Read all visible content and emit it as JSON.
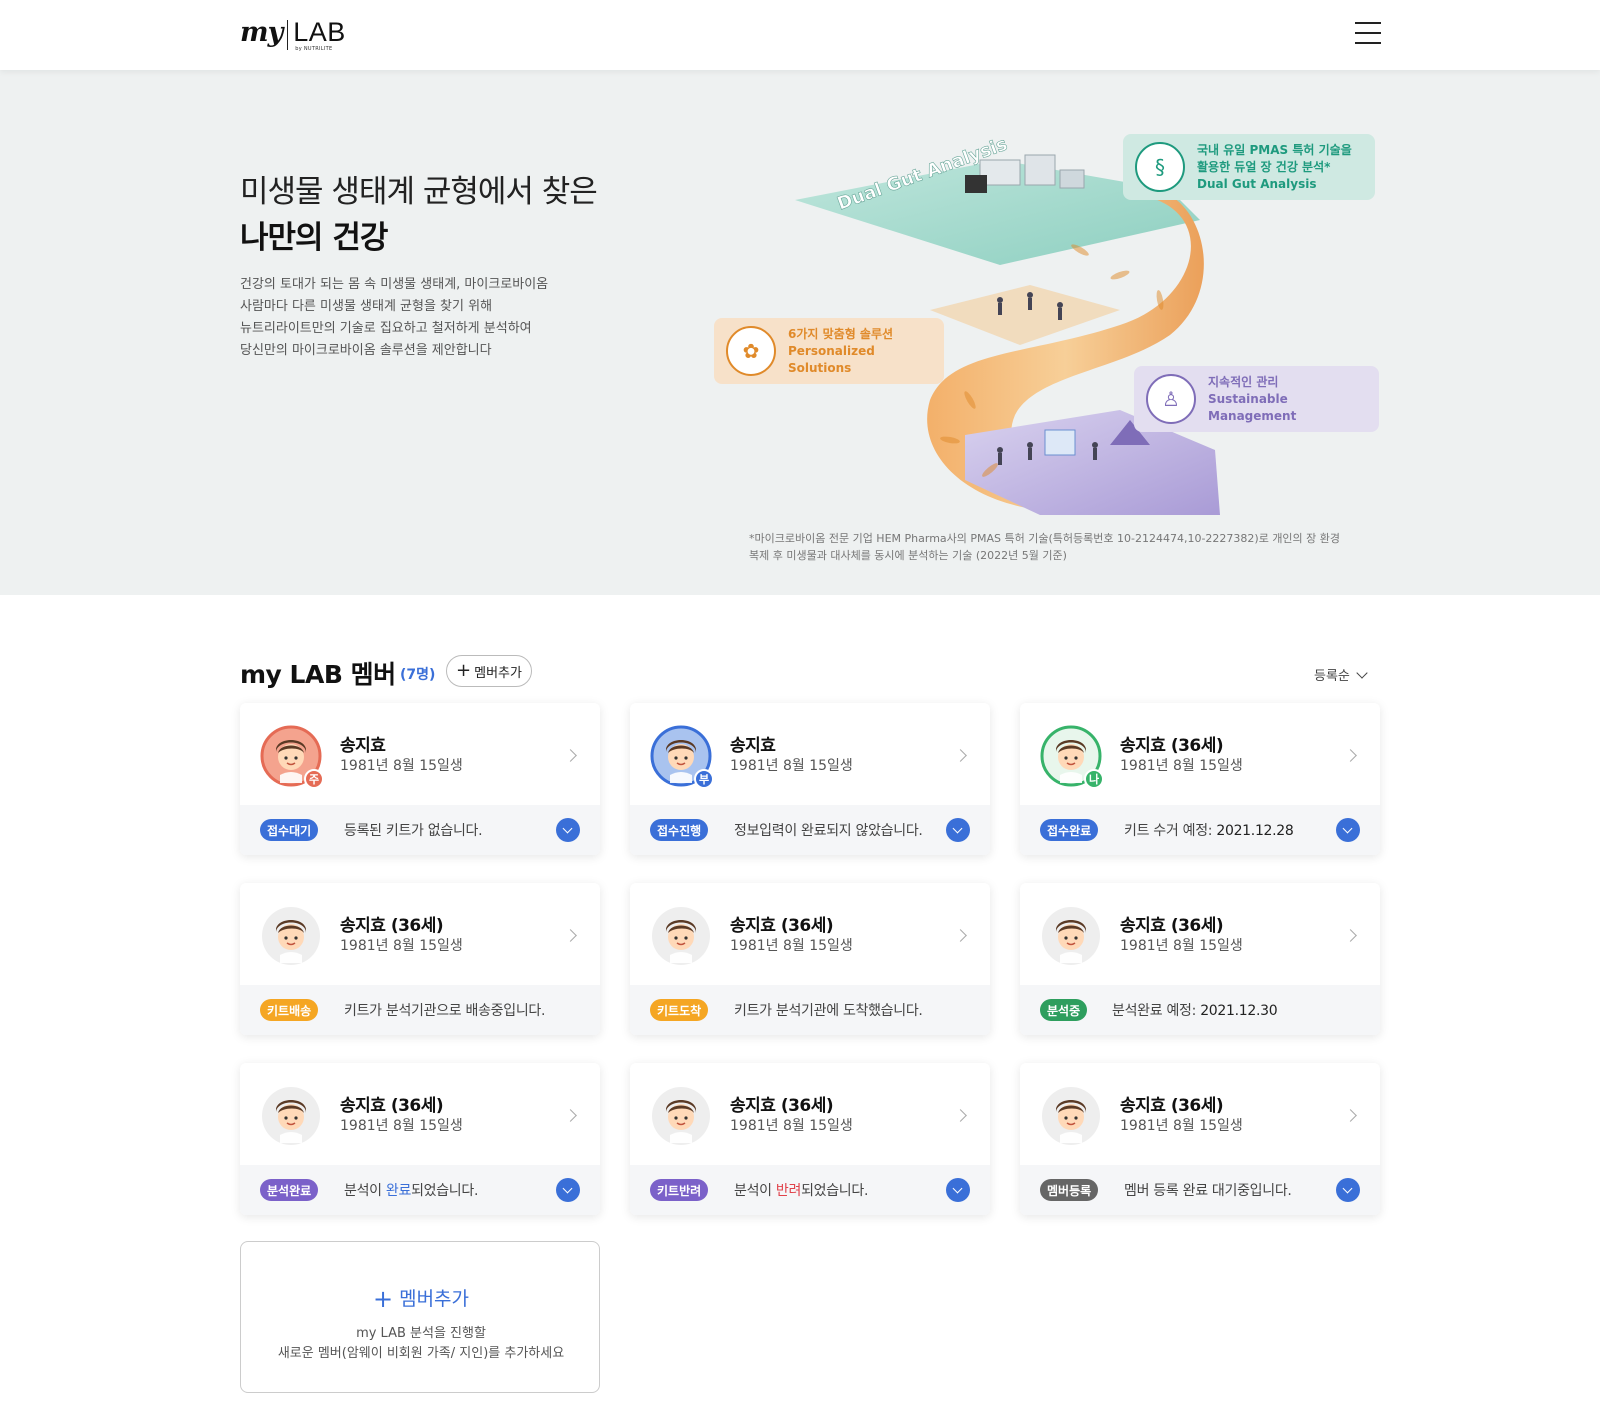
{
  "header": {
    "logo_my": "my",
    "logo_lab": "LAB",
    "logo_by": "by NUTRILITE"
  },
  "hero": {
    "title_line1": "미생물 생태계 균형에서 찾은",
    "title_line2": "나만의 건강",
    "desc": [
      "건강의 토대가 되는 몸 속 미생물 생태계, 마이크로바이옴",
      "사람마다 다른 미생물 생태계 균형을 찾기 위해",
      "뉴트리라이트만의 기술로 집요하고 철저하게 분석하여",
      "당신만의 마이크로바이옴 솔루션을 제안합니다"
    ],
    "illus_label": "Dual Gut Analysis",
    "bubbles": [
      {
        "line1": "국내 유일 PMAS 특허 기술을",
        "line2": "활용한 듀얼 장 건강 분석*",
        "line3": "Dual Gut Analysis",
        "color": "#1e9a7e"
      },
      {
        "line1": "6가지 맞춤형 솔루션",
        "line2": "Personalized Solutions",
        "color": "#e08a2a"
      },
      {
        "line1": "지속적인 관리",
        "line2": "Sustainable Management",
        "color": "#7f6db8"
      }
    ],
    "note": [
      "*마이크로바이옴 전문 기업 HEM Pharma사의 PMAS 특허 기술(특허등록번호 10-2124474,10-2227382)로 개인의 장 환경",
      "복제 후 미생물과 대사체를 동시에 분석하는 기술 (2022년 5월 기준)"
    ]
  },
  "members": {
    "title": "my LAB 멤버",
    "count": "(7명)",
    "add_button": "멤버추가",
    "sort_label": "등록순",
    "cards": [
      {
        "name": "송지효",
        "birth": "1981년 8월 15일생",
        "badge": "접수대기",
        "badge_color": "#3a6fd8",
        "status": "등록된 키트가 없습니다.",
        "av_bg": "#f4a38e",
        "av_ring": "#e56b55",
        "av_badge": "주",
        "av_badge_color": "#e56b55",
        "expand": true
      },
      {
        "name": "송지효",
        "birth": "1981년 8월 15일생",
        "badge": "접수진행",
        "badge_color": "#3a6fd8",
        "status": "정보입력이 완료되지 않았습니다.",
        "av_bg": "#a9c3ef",
        "av_ring": "#3a6fd8",
        "av_badge": "부",
        "av_badge_color": "#3a6fd8",
        "expand": true
      },
      {
        "name": "송지효 (36세)",
        "birth": "1981년 8월 15일생",
        "badge": "접수완료",
        "badge_color": "#3a6fd8",
        "status_pre": "키트 수거 예정: ",
        "status_val": "2021.12.28",
        "av_bg": "#e8f6ec",
        "av_ring": "#37b36a",
        "av_badge": "나",
        "av_badge_color": "#37b36a",
        "expand": true
      },
      {
        "name": "송지효 (36세)",
        "birth": "1981년 8월 15일생",
        "badge": "키트배송",
        "badge_color": "#f5a623",
        "status": "키트가 분석기관으로 배송중입니다.",
        "av_bg": "#eeeeee"
      },
      {
        "name": "송지효 (36세)",
        "birth": "1981년 8월 15일생",
        "badge": "키트도착",
        "badge_color": "#f5a623",
        "status": "키트가 분석기관에 도착했습니다.",
        "av_bg": "#eeeeee"
      },
      {
        "name": "송지효 (36세)",
        "birth": "1981년 8월 15일생",
        "badge": "분석중",
        "badge_color": "#2e9e5e",
        "status_pre": "분석완료 예정: ",
        "status_val": "2021.12.30",
        "av_bg": "#eeeeee"
      },
      {
        "name": "송지효 (36세)",
        "birth": "1981년 8월 15일생",
        "badge": "분석완료",
        "badge_color": "#7b61c9",
        "status_a": "분석이 ",
        "status_hl": "완료",
        "status_b": "되었습니다.",
        "hl": "blue",
        "av_bg": "#eeeeee",
        "expand": true
      },
      {
        "name": "송지효 (36세)",
        "birth": "1981년 8월 15일생",
        "badge": "키트반려",
        "badge_color": "#7b61c9",
        "status_a": "분석이 ",
        "status_hl": "반려",
        "status_b": "되었습니다.",
        "hl": "red",
        "av_bg": "#eeeeee",
        "expand": true
      },
      {
        "name": "송지효 (36세)",
        "birth": "1981년 8월 15일생",
        "badge": "멤버등록",
        "badge_color": "#666666",
        "status": "멤버 등록 완료 대기중입니다.",
        "av_bg": "#eeeeee",
        "expand": true
      }
    ],
    "add_card": {
      "title": "멤버추가",
      "desc1": "my LAB 분석을 진행할",
      "desc2": "새로운 멤버(암웨이 비회원 가족/ 지인)를 추가하세요"
    }
  },
  "colors": {
    "accent": "#3a6fd8",
    "hero_bg": "#eef1f1"
  }
}
